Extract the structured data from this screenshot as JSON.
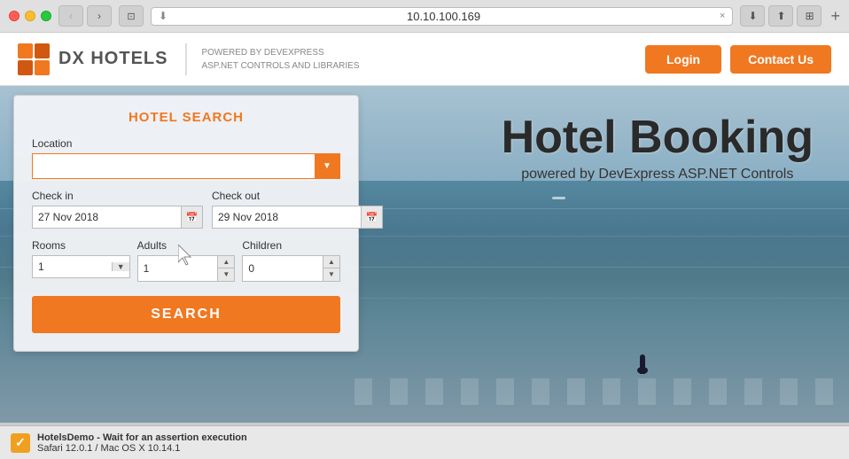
{
  "browser": {
    "address": "10.10.100.169",
    "close_tab": "×",
    "nav_back": "‹",
    "nav_forward": "›",
    "window_btn": "⊡",
    "download_icon": "⬇",
    "share_icon": "⬆",
    "expand_icon": "⊞",
    "new_tab": "+"
  },
  "header": {
    "logo_text_dx": "DX",
    "logo_text_hotels": " HOTELS",
    "tagline_line1": "POWERED BY DEVEXPRESS",
    "tagline_line2": "ASP.NET CONTROLS AND LIBRARIES",
    "login_label": "Login",
    "contact_label": "Contact Us"
  },
  "hero": {
    "title": "Hotel Booking",
    "subtitle": "powered by DevExpress ASP.NET Controls"
  },
  "search": {
    "panel_title": "HOTEL SEARCH",
    "location_label": "Location",
    "location_placeholder": "",
    "checkin_label": "Check in",
    "checkin_value": "27 Nov 2018",
    "checkout_label": "Check out",
    "checkout_value": "29 Nov 2018",
    "rooms_label": "Rooms",
    "rooms_value": "1",
    "adults_label": "Adults",
    "adults_value": "1",
    "children_label": "Children",
    "children_value": "0",
    "search_button": "SEARCH"
  },
  "status_bar": {
    "icon": "✓",
    "title": "HotelsDemo - Wait for an assertion execution",
    "subtitle": "Safari 12.0.1 / Mac OS X 10.14.1"
  }
}
